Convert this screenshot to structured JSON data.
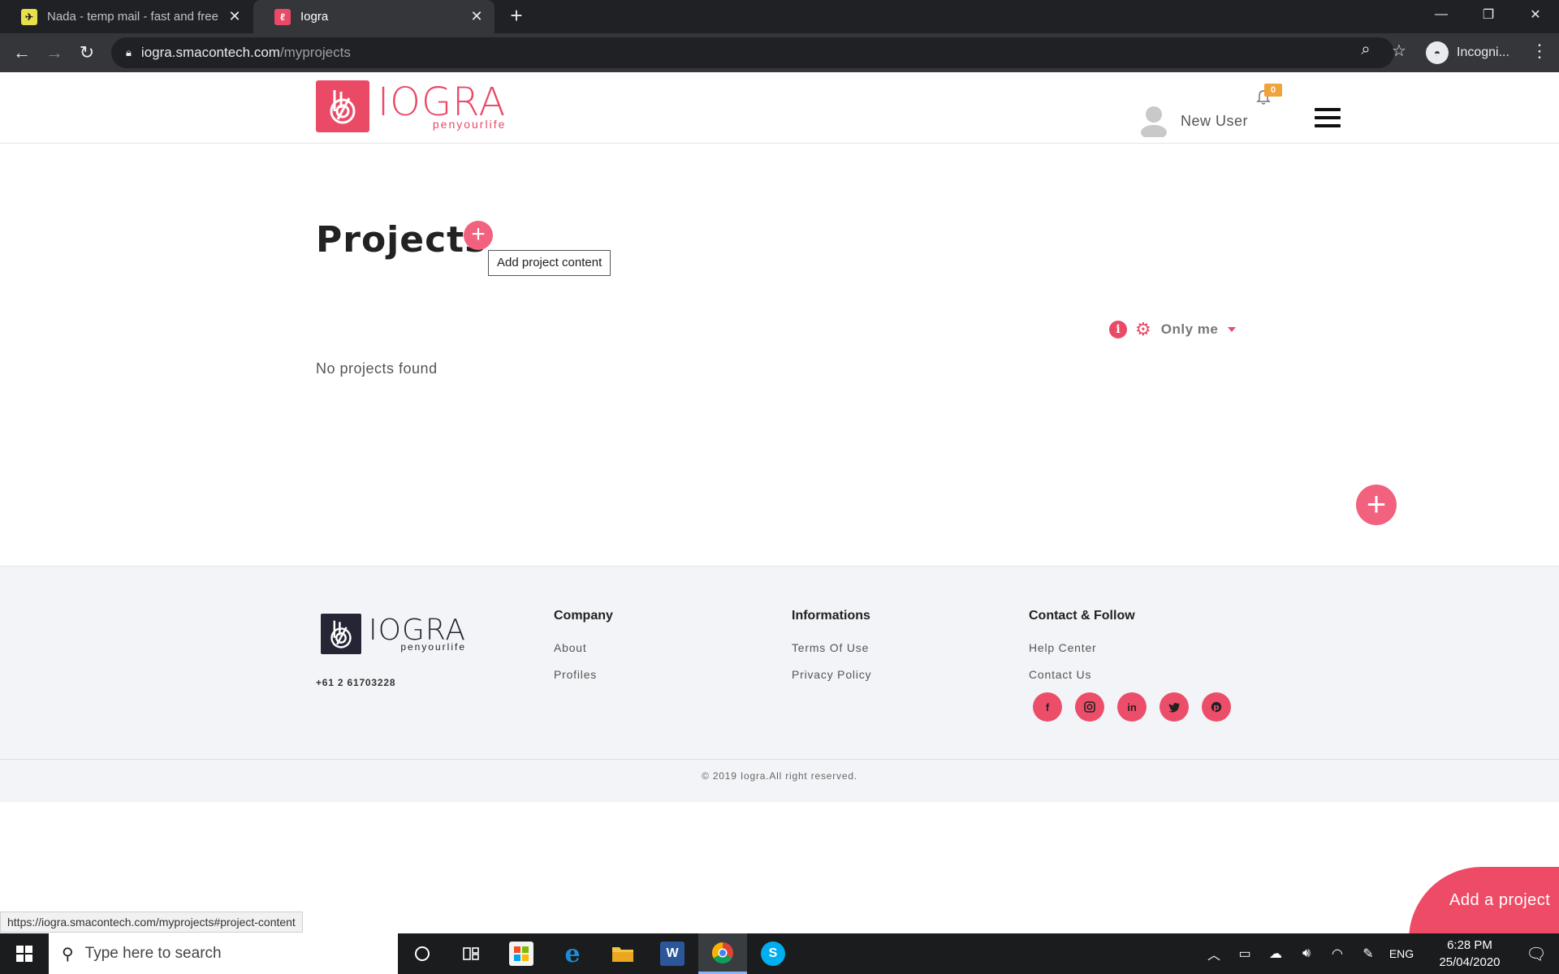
{
  "browser": {
    "tabs": [
      {
        "title": "Nada - temp mail - fast and free",
        "favicon": "nada-favicon"
      },
      {
        "title": "Iogra",
        "favicon": "iogra-favicon"
      }
    ],
    "address": {
      "host": "iogra.smacontech.com",
      "path": "/myprojects"
    },
    "profile_label": "Incogni..."
  },
  "header": {
    "logo": {
      "word": "IOGRA",
      "tagline": "penyourlife"
    },
    "user_name": "New User",
    "notification_count": "0"
  },
  "main": {
    "title": "Projects",
    "add_tooltip": "Add project content",
    "filter_label": "Only me",
    "empty_message": "No projects found"
  },
  "footer": {
    "logo": {
      "word": "IOGRA",
      "tagline": "penyourlife"
    },
    "phone": "+61 2 61703228",
    "columns": [
      {
        "title": "Company",
        "links": [
          "About",
          "Profiles"
        ]
      },
      {
        "title": "Informations",
        "links": [
          "Terms Of Use",
          "Privacy Policy"
        ]
      },
      {
        "title": "Contact & Follow",
        "links": [
          "Help Center",
          "Contact Us"
        ]
      }
    ],
    "socials": [
      "facebook-icon",
      "instagram-icon",
      "linkedin-icon",
      "twitter-icon",
      "pinterest-icon"
    ],
    "copyright": "© 2019 Iogra.All right reserved."
  },
  "status_url": "https://iogra.smacontech.com/myprojects#project-content",
  "fab_label": "Add a project",
  "taskbar": {
    "search_placeholder": "Type here to search",
    "language": "ENG",
    "time": "6:28 PM",
    "date": "25/04/2020"
  },
  "colors": {
    "accent": "#e94a67",
    "badge": "#f0a23b",
    "footer_bg": "#f2f4f7"
  }
}
